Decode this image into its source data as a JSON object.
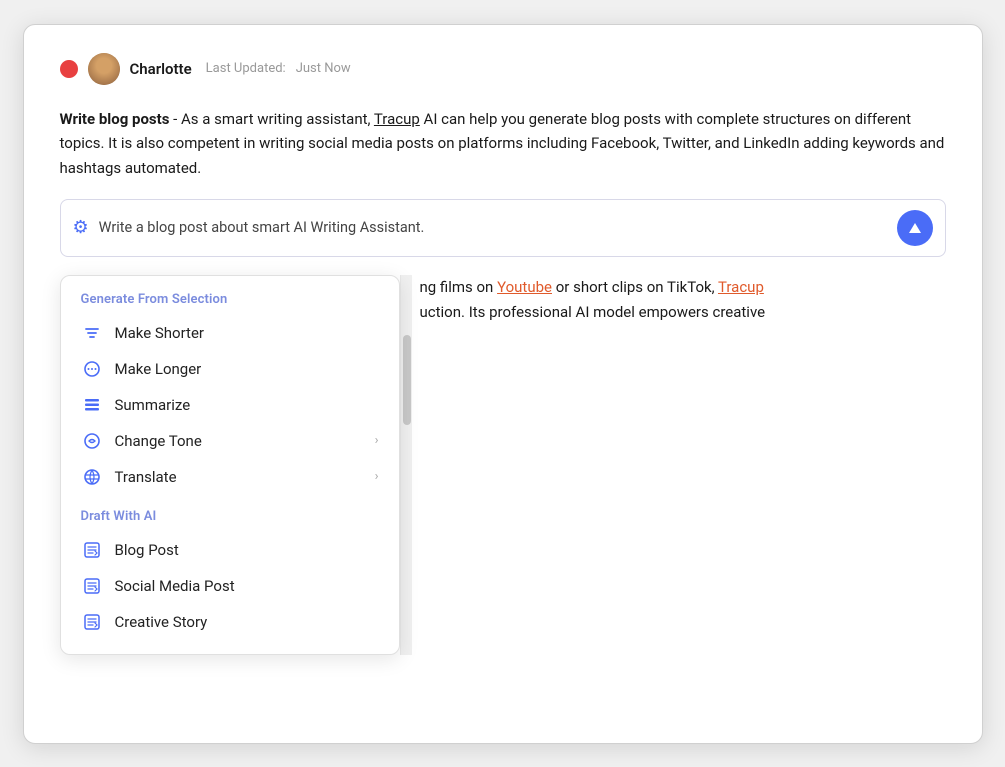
{
  "header": {
    "user_name": "Charlotte",
    "last_updated_label": "Last Updated:",
    "last_updated_value": "Just Now"
  },
  "content": {
    "paragraph_bold": "Write blog posts",
    "paragraph_text": " - As a smart writing assistant, Tracup AI can help you generate blog posts with complete structures on different topics. It is also competent in writing social media posts on platforms including Facebook, Twitter, and LinkedIn adding keywords and hashtags automated.",
    "tracup_link": "Tracup",
    "right_text_1": "ng films on ",
    "right_link_1": "Youtube",
    "right_text_2": " or short clips on TikTok, ",
    "right_link_2": "Tracup",
    "right_text_3": " uction. Its professional AI model empowers creative"
  },
  "input_bar": {
    "placeholder": "Write a blog post about smart AI Writing Assistant.",
    "icon": "⚙",
    "btn_icon": "▲"
  },
  "dropdown": {
    "section1_label": "Generate From Selection",
    "items": [
      {
        "icon": "filter",
        "label": "Make Shorter",
        "arrow": false
      },
      {
        "icon": "dots-circle",
        "label": "Make Longer",
        "arrow": false
      },
      {
        "icon": "list",
        "label": "Summarize",
        "arrow": false
      },
      {
        "icon": "refresh-circle",
        "label": "Change Tone",
        "arrow": true
      },
      {
        "icon": "globe",
        "label": "Translate",
        "arrow": true
      }
    ],
    "section2_label": "Draft With AI",
    "items2": [
      {
        "icon": "edit-box",
        "label": "Blog Post",
        "arrow": false
      },
      {
        "icon": "edit-box",
        "label": "Social Media Post",
        "arrow": false
      },
      {
        "icon": "edit-box",
        "label": "Creative Story",
        "arrow": false
      }
    ]
  }
}
